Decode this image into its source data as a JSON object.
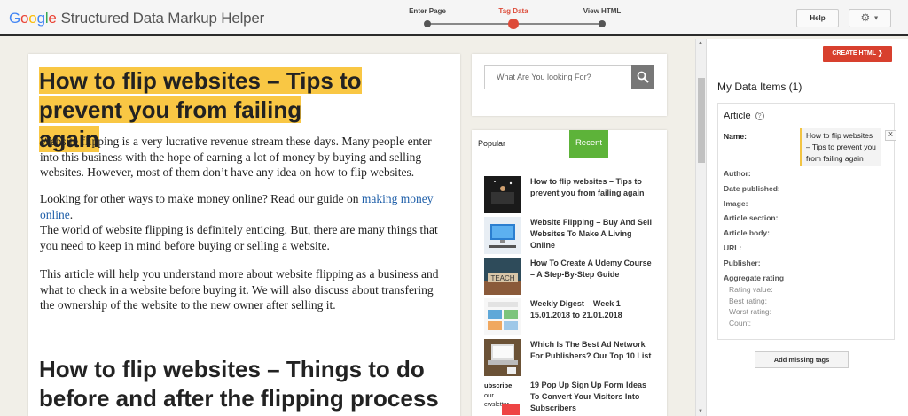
{
  "header": {
    "logo_g1": "G",
    "logo_o1": "o",
    "logo_o2": "o",
    "logo_g2": "g",
    "logo_l": "l",
    "logo_e": "e",
    "app_name": "Structured Data Markup Helper",
    "steps": [
      {
        "label": "Enter Page",
        "active": false
      },
      {
        "label": "Tag Data",
        "active": true
      },
      {
        "label": "View HTML",
        "active": false
      }
    ],
    "help_label": "Help",
    "gear_icon": "gear-icon",
    "accent_color": "#dd4b39"
  },
  "article": {
    "title": "How to flip websites – Tips to prevent you from failing again",
    "highlight_color": "#f9c744",
    "p1": "Website flipping is a very lucrative revenue stream these days. Many people enter into this business with the hope of earning a lot of money by buying and selling websites. However, most of them don’t have any idea on how to flip websites.",
    "p2_before": "Looking for other ways to make money online? Read our guide on ",
    "p2_link": "making money online",
    "p2_after": ".",
    "p3": "The world of website flipping is definitely enticing. But, there are many things that you need to keep in mind before buying or selling a website.",
    "p4": "This article will help you understand more about website flipping as a business and what to check in a website before buying it. We will also discuss about transfering the ownership of the website to the new owner after selling it.",
    "h2": "How to flip websites – Things to do before and after the flipping process"
  },
  "sidebar": {
    "search_placeholder": "What Are You looking For?",
    "tab_popular": "Popular",
    "tab_recent": "Recent",
    "recent_color": "#5db339",
    "posts": [
      {
        "title": "How to flip websites – Tips to prevent you from failing again"
      },
      {
        "title": "Website Flipping – Buy And Sell Websites To Make A Living Online"
      },
      {
        "title": "How To Create A Udemy Course – A Step-By-Step Guide"
      },
      {
        "title": "Weekly Digest – Week 1 – 15.01.2018 to 21.01.2018"
      },
      {
        "title": "Which Is The Best Ad Network For Publishers? Our Top 10 List"
      },
      {
        "title": "19 Pop Up Sign Up Form Ideas To Convert Your Visitors Into Subscribers"
      }
    ],
    "thumb_teach_text": "TEACH",
    "thumb_subscribe_text": "ubscribe",
    "thumb_subscribe_text2": "our",
    "thumb_subscribe_text3": "ewsletter"
  },
  "data_items": {
    "create_html_label": "CREATE HTML ❯",
    "heading": "My Data Items (1)",
    "type": "Article",
    "help_icon": "?",
    "name_label": "Name:",
    "name_value": "How to flip websites – Tips to prevent you from failing again",
    "remove_label": "X",
    "fields": [
      "Author:",
      "Date published:",
      "Image:",
      "Article section:",
      "Article body:",
      "URL:",
      "Publisher:"
    ],
    "aggregate_label": "Aggregate rating",
    "aggregate_fields": [
      "Rating value:",
      "Best rating:",
      "Worst rating:",
      "Count:"
    ],
    "add_missing_label": "Add missing tags"
  }
}
